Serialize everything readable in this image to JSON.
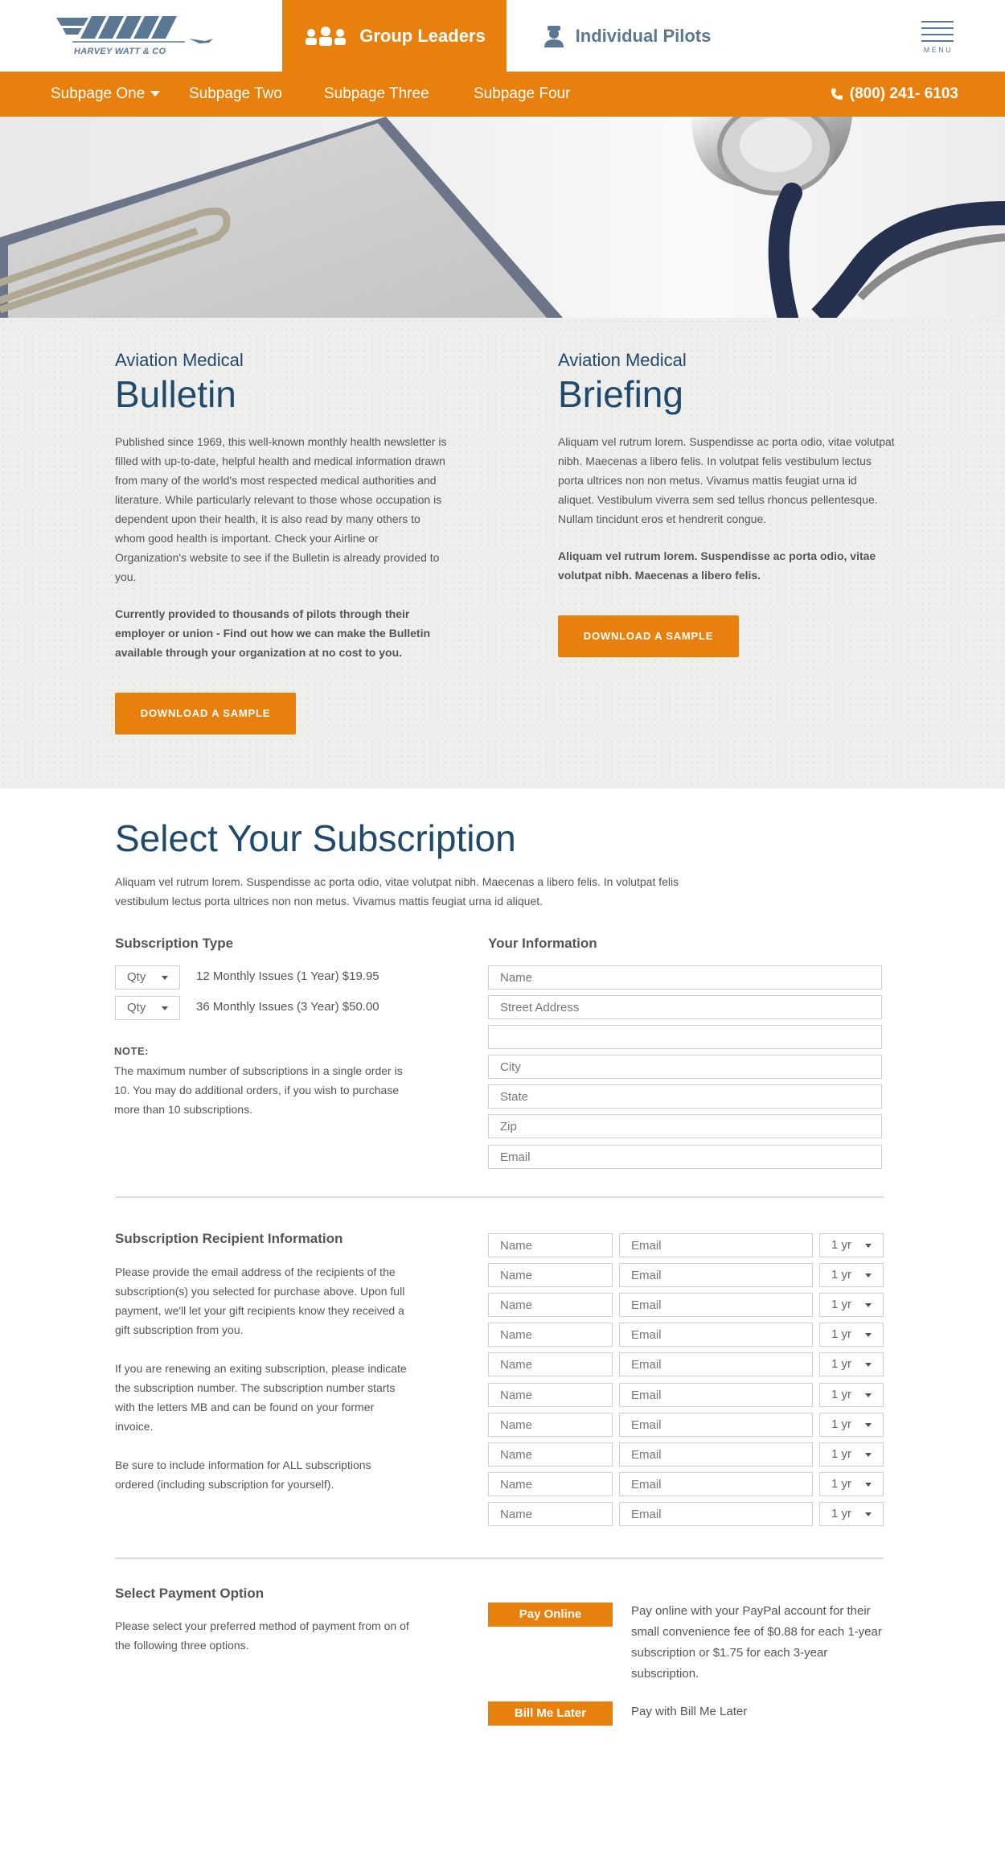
{
  "header": {
    "logo_text": "HARVEY WATT & CO",
    "tabs": [
      {
        "label": "Group Leaders",
        "active": true
      },
      {
        "label": "Individual Pilots",
        "active": false
      }
    ],
    "menu_label": "MENU"
  },
  "nav": {
    "items": [
      "Subpage One",
      "Subpage Two",
      "Subpage Three",
      "Subpage Four"
    ],
    "phone": "(800) 241- 6103"
  },
  "colors": {
    "accent": "#e8800d",
    "heading": "#1f4a6b",
    "brand_blue": "#5b7893"
  },
  "bulletin": {
    "eyebrow": "Aviation Medical",
    "title": "Bulletin",
    "body": "Published since 1969, this well-known monthly health newsletter is filled with up-to-date, helpful health and medical information drawn from many of the world's most respected medical authorities and literature. While particularly relevant to those whose occupation is dependent upon their health, it is also read by many others to whom good health is important. Check your Airline or Organization's website to see if the Bulletin is already provided to you.",
    "bold": "Currently provided to thousands of pilots through their employer or union - Find out how we can make the Bulletin available through your organization at no cost to you.",
    "button": "DOWNLOAD A SAMPLE"
  },
  "briefing": {
    "eyebrow": "Aviation Medical",
    "title": "Briefing",
    "body": "Aliquam vel rutrum lorem. Suspendisse ac porta odio, vitae volutpat nibh. Maecenas a libero felis. In volutpat felis vestibulum lectus porta ultrices non non metus. Vivamus mattis feugiat urna id aliquet. Vestibulum viverra sem sed tellus rhoncus pellentesque. Nullam tincidunt eros et hendrerit congue.",
    "bold": "Aliquam vel rutrum lorem. Suspendisse ac porta odio, vitae volutpat nibh. Maecenas a libero felis.",
    "button": "DOWNLOAD A SAMPLE"
  },
  "subscription": {
    "title": "Select Your Subscription",
    "intro": "Aliquam vel rutrum lorem. Suspendisse ac porta odio, vitae volutpat nibh. Maecenas a libero felis. In volutpat felis vestibulum lectus porta ultrices non non metus. Vivamus mattis feugiat urna id aliquet.",
    "type_label": "Subscription Type",
    "options": [
      {
        "qty": "Qty",
        "label": "12 Monthly Issues (1 Year) $19.95"
      },
      {
        "qty": "Qty",
        "label": "36 Monthly Issues (3 Year) $50.00"
      }
    ],
    "note_head": "NOTE:",
    "note": "The maximum number of subscriptions in a single order is 10. You may do additional orders, if you wish to purchase more than 10 subscriptions.",
    "info_label": "Your Information",
    "info_fields": [
      "Name",
      "Street Address",
      "",
      "City",
      "State",
      "Zip",
      "Email"
    ]
  },
  "recipients": {
    "title": "Subscription Recipient Information",
    "p1": "Please provide the email address of the recipients of the subscription(s) you selected for purchase above. Upon full payment, we'll let your gift recipients know they received a gift subscription from you.",
    "p2": "If you are renewing an exiting subscription, please indicate the subscription number. The subscription number starts with the letters MB and can be found on your former invoice.",
    "p3": "Be sure to include information for ALL subscriptions ordered (including subscription for yourself).",
    "rows": [
      {
        "name": "Name",
        "email": "Email",
        "term": "1 yr"
      },
      {
        "name": "Name",
        "email": "Email",
        "term": "1 yr"
      },
      {
        "name": "Name",
        "email": "Email",
        "term": "1 yr"
      },
      {
        "name": "Name",
        "email": "Email",
        "term": "1 yr"
      },
      {
        "name": "Name",
        "email": "Email",
        "term": "1 yr"
      },
      {
        "name": "Name",
        "email": "Email",
        "term": "1 yr"
      },
      {
        "name": "Name",
        "email": "Email",
        "term": "1 yr"
      },
      {
        "name": "Name",
        "email": "Email",
        "term": "1 yr"
      },
      {
        "name": "Name",
        "email": "Email",
        "term": "1 yr"
      },
      {
        "name": "Name",
        "email": "Email",
        "term": "1 yr"
      }
    ]
  },
  "payment": {
    "title": "Select Payment Option",
    "text": "Please select your preferred method of payment from on of the following three options.",
    "options": [
      {
        "button": "Pay Online",
        "desc": "Pay online with your PayPal account for their small convenience fee of $0.88 for each 1-year subscription or $1.75 for each 3-year subscription."
      },
      {
        "button": "Bill Me Later",
        "desc": "Pay with Bill Me Later"
      }
    ]
  }
}
